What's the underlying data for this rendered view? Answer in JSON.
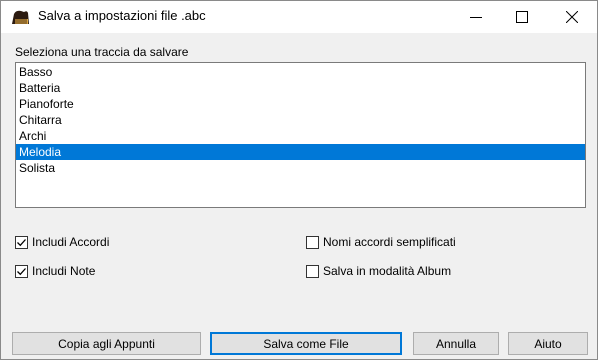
{
  "window": {
    "title": "Salva a impostazioni file .abc",
    "controls": {
      "minimize": "minimize-icon",
      "maximize": "maximize-icon",
      "close": "close-icon"
    }
  },
  "track_list": {
    "label": "Seleziona una traccia da salvare",
    "items": [
      "Basso",
      "Batteria",
      "Pianoforte",
      "Chitarra",
      "Archi",
      "Melodia",
      "Solista"
    ],
    "selected": "Melodia"
  },
  "options": {
    "includi_accordi": {
      "label": "Includi Accordi",
      "checked": true
    },
    "includi_note": {
      "label": "Includi Note",
      "checked": true
    },
    "nomi_accordi": {
      "label": "Nomi accordi semplificati",
      "checked": false
    },
    "salva_album": {
      "label": "Salva in modalità Album",
      "checked": false
    }
  },
  "buttons": {
    "copia": "Copia agli Appunti",
    "salva": "Salva come File",
    "annulla": "Annulla",
    "aiuto": "Aiuto"
  },
  "colors": {
    "selection": "#0078d7",
    "dialog_bg": "#f0f0f0"
  }
}
